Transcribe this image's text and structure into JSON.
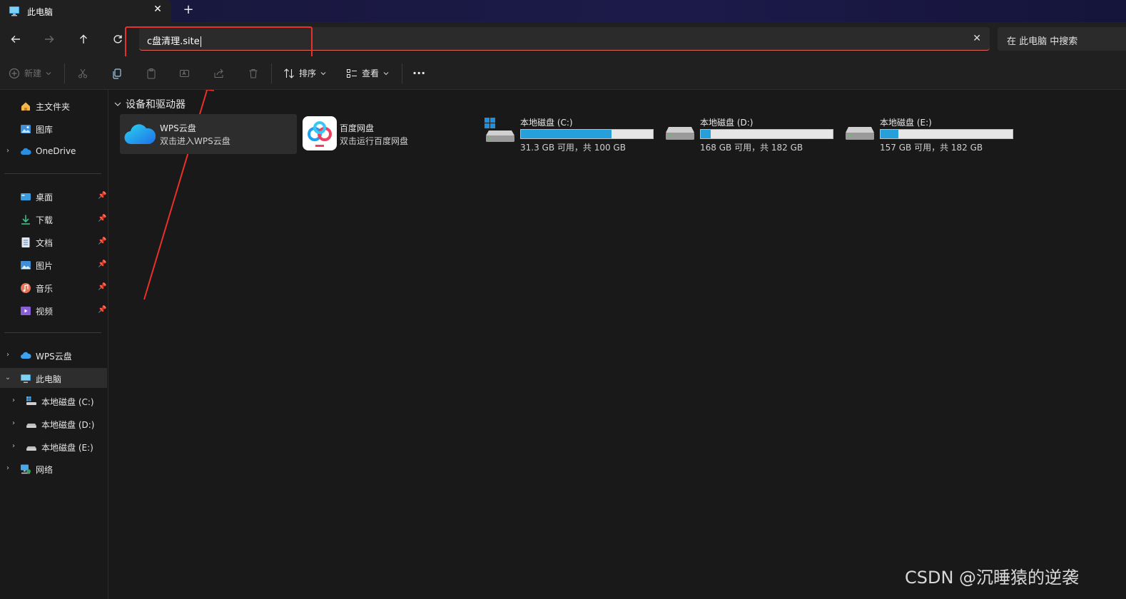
{
  "tab": {
    "title": "此电脑",
    "close": "✕",
    "new_tab": "+"
  },
  "nav": {
    "back": "←",
    "forward": "→",
    "up": "↑",
    "refresh": "↻"
  },
  "address": {
    "value": "c盘清理.site",
    "clear": "✕"
  },
  "search": {
    "placeholder": "在 此电脑 中搜索"
  },
  "toolbar": {
    "new_label": "新建",
    "sort_label": "排序",
    "view_label": "查看",
    "more_label": "···"
  },
  "sidebar": {
    "top": [
      {
        "label": "主文件夹"
      },
      {
        "label": "图库"
      },
      {
        "label": "OneDrive"
      }
    ],
    "quick_access": [
      {
        "label": "桌面"
      },
      {
        "label": "下载"
      },
      {
        "label": "文档"
      },
      {
        "label": "图片"
      },
      {
        "label": "音乐"
      },
      {
        "label": "视频"
      }
    ],
    "tree": [
      {
        "label": "WPS云盘"
      },
      {
        "label": "此电脑"
      },
      {
        "label": "本地磁盘 (C:)"
      },
      {
        "label": "本地磁盘 (D:)"
      },
      {
        "label": "本地磁盘 (E:)"
      },
      {
        "label": "网络"
      }
    ]
  },
  "content": {
    "group_title": "设备和驱动器",
    "apps": [
      {
        "name": "WPS云盘",
        "desc": "双击进入WPS云盘"
      },
      {
        "name": "百度网盘",
        "desc": "双击运行百度网盘"
      }
    ],
    "drives": [
      {
        "name": "本地磁盘 (C:)",
        "free": "31.3 GB 可用，共 100 GB",
        "used_fraction": 0.687
      },
      {
        "name": "本地磁盘 (D:)",
        "free": "168 GB 可用，共 182 GB",
        "used_fraction": 0.077
      },
      {
        "name": "本地磁盘 (E:)",
        "free": "157 GB 可用，共 182 GB",
        "used_fraction": 0.137
      }
    ]
  },
  "watermark": "CSDN @沉睡猿的逆袭",
  "colors": {
    "accent": "#26a0da",
    "annotation_red": "#e8312a"
  }
}
